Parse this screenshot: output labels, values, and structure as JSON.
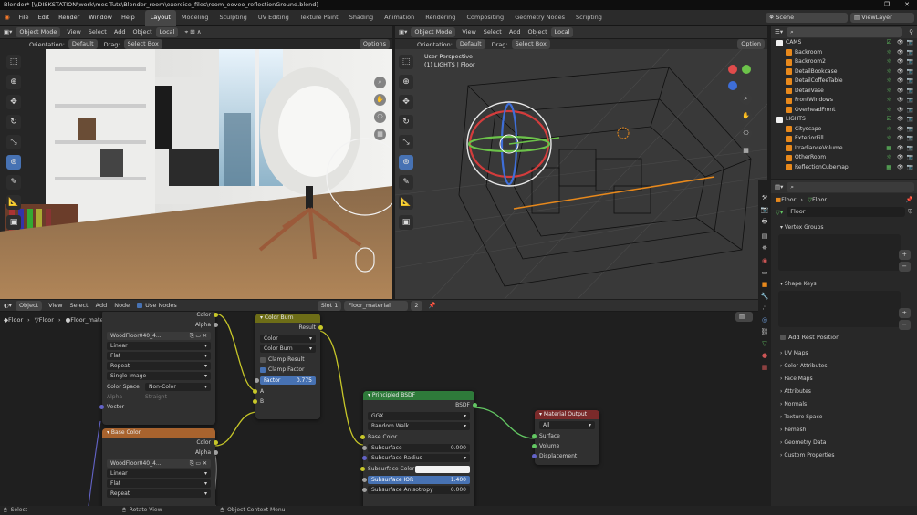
{
  "window": {
    "title": "Blender* [\\\\DISKSTATION\\work\\mes Tuts\\Blender_room\\exercice_files\\room_eevee_reflectionGround.blend]",
    "min": "—",
    "max": "❐",
    "close": "✕"
  },
  "menus": [
    "File",
    "Edit",
    "Render",
    "Window",
    "Help"
  ],
  "workspaces": [
    "Layout",
    "Modeling",
    "Sculpting",
    "UV Editing",
    "Texture Paint",
    "Shading",
    "Animation",
    "Rendering",
    "Compositing",
    "Geometry Nodes",
    "Scripting"
  ],
  "scene": "Scene",
  "view_layer": "ViewLayer",
  "vp_left": {
    "mode": "Object Mode",
    "menus": [
      "View",
      "Select",
      "Add",
      "Object"
    ],
    "transform": "Local",
    "orientation_label": "Orientation:",
    "orientation": "Default",
    "drag_label": "Drag:",
    "drag": "Select Box",
    "options": "Options"
  },
  "vp_right": {
    "mode": "Object Mode",
    "menus": [
      "View",
      "Select",
      "Add",
      "Object"
    ],
    "transform": "Local",
    "orientation_label": "Orientation:",
    "orientation": "Default",
    "drag_label": "Drag:",
    "drag": "Select Box",
    "options": "Option",
    "persp": "User Perspective",
    "collection": "(1) LIGHTS | Floor"
  },
  "node_editor": {
    "type": "Object",
    "menus": [
      "View",
      "Select",
      "Add",
      "Node"
    ],
    "use_nodes": "Use Nodes",
    "slot": "Slot 1",
    "material": "Floor_material",
    "users": "2",
    "breadcrumb": [
      "Floor",
      "Floor",
      "Floor_material"
    ]
  },
  "nodes": {
    "img1": {
      "image": "WoodFloor040_4...",
      "interp": "Linear",
      "proj": "Flat",
      "ext": "Repeat",
      "src": "Single Image",
      "cs_label": "Color Space",
      "cs": "Non-Color",
      "alpha_label": "Alpha",
      "alpha": "Straight",
      "vector": "Vector",
      "out_color": "Color",
      "out_alpha": "Alpha"
    },
    "basecolor": {
      "title": "Base Color",
      "image": "WoodFloor040_4...",
      "interp": "Linear",
      "proj": "Flat",
      "ext": "Repeat",
      "out_color": "Color",
      "out_alpha": "Alpha"
    },
    "burn": {
      "title": "Color Burn",
      "result": "Result",
      "mode1": "Color",
      "mode2": "Color Burn",
      "clamp_result": "Clamp Result",
      "clamp_factor": "Clamp Factor",
      "factor_label": "Factor",
      "factor": "0.775",
      "a": "A",
      "b": "B"
    },
    "bsdf": {
      "title": "Principled BSDF",
      "out": "BSDF",
      "dist": "GGX",
      "sss": "Random Walk",
      "base": "Base Color",
      "subsurface": "Subsurface",
      "subsurface_v": "0.000",
      "radius": "Subsurface Radius",
      "sscolor": "Subsurface Color",
      "ior": "Subsurface IOR",
      "ior_v": "1.400",
      "aniso": "Subsurface Anisotropy",
      "aniso_v": "0.000"
    },
    "out": {
      "title": "Material Output",
      "target": "All",
      "surface": "Surface",
      "volume": "Volume",
      "disp": "Displacement"
    }
  },
  "outliner": [
    {
      "label": "CAMS",
      "type": "coll",
      "indent": 0
    },
    {
      "label": "Backroom",
      "type": "cam",
      "indent": 1
    },
    {
      "label": "Backroom2",
      "type": "cam",
      "indent": 1
    },
    {
      "label": "DetailBookcase",
      "type": "cam",
      "indent": 1
    },
    {
      "label": "DetailCoffeeTable",
      "type": "cam",
      "indent": 1
    },
    {
      "label": "DetailVase",
      "type": "cam",
      "indent": 1
    },
    {
      "label": "FrontWindows",
      "type": "cam",
      "indent": 1
    },
    {
      "label": "OverheadFront",
      "type": "cam",
      "indent": 1
    },
    {
      "label": "LIGHTS",
      "type": "coll",
      "indent": 0
    },
    {
      "label": "Cityscape",
      "type": "light",
      "indent": 1
    },
    {
      "label": "ExteriorFill",
      "type": "light",
      "indent": 1
    },
    {
      "label": "IrradianceVolume",
      "type": "probe",
      "indent": 1
    },
    {
      "label": "OtherRoom",
      "type": "light",
      "indent": 1
    },
    {
      "label": "ReflectionCubemap",
      "type": "probe",
      "indent": 1
    }
  ],
  "props": {
    "obj": "Floor",
    "data": "Floor",
    "mesh": "Floor",
    "sec_vg": "Vertex Groups",
    "sec_sk": "Shape Keys",
    "add_rest": "Add Rest Position",
    "sections": [
      "UV Maps",
      "Color Attributes",
      "Face Maps",
      "Attributes",
      "Normals",
      "Texture Space",
      "Remesh",
      "Geometry Data",
      "Custom Properties"
    ]
  },
  "status": {
    "select": "Select",
    "rotate": "Rotate View",
    "ctx": "Object Context Menu"
  },
  "colors": {
    "accent": "#4772b3",
    "node_color": "#c7c729",
    "node_shader": "#63c763"
  }
}
